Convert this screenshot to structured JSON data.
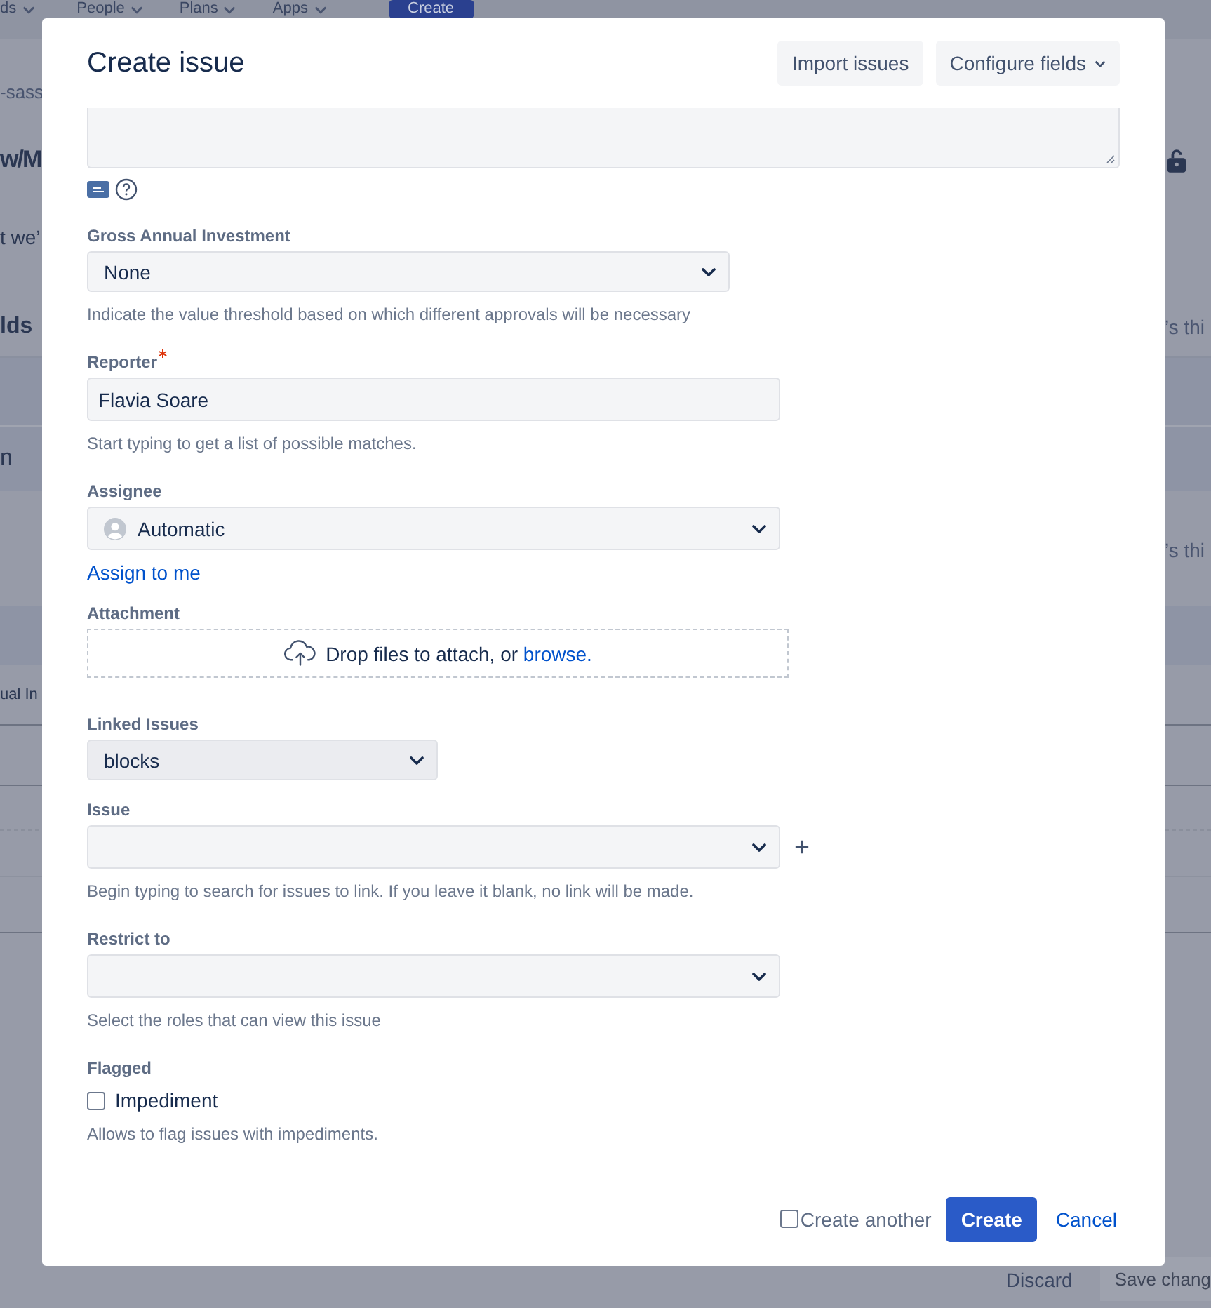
{
  "background_page": {
    "nav_items": [
      {
        "label": "ds"
      },
      {
        "label": "People"
      },
      {
        "label": "Plans"
      },
      {
        "label": "Apps"
      }
    ],
    "nav_create": "Create",
    "breadcrumb": "-sass",
    "heading": "w/M",
    "intro": "t we’",
    "section_title": "lds",
    "row_text": "n",
    "right_texts": [
      "’s thi",
      "’s thi"
    ],
    "field_row": "ual In",
    "discard": "Discard",
    "save": "Save chang"
  },
  "dialog": {
    "title": "Create issue",
    "header_buttons": [
      {
        "label": "Import issues",
        "kind": "plain"
      },
      {
        "label": "Configure fields",
        "kind": "dropdown"
      }
    ],
    "fields": [
      {
        "kind": "textarea"
      },
      {
        "kind": "select",
        "label": "Gross Annual Investment",
        "value": "None",
        "help": "Indicate the value threshold based on which different approvals will be necessary"
      },
      {
        "kind": "text",
        "label": "Reporter",
        "required": true,
        "value": "Flavia Soare",
        "help": "Start typing to get a list of possible matches."
      },
      {
        "kind": "user",
        "label": "Assignee",
        "value": "Automatic",
        "link": "Assign to me"
      },
      {
        "kind": "attachment",
        "label": "Attachment",
        "prompt": "Drop files to attach, or",
        "link": "browse."
      },
      {
        "kind": "link-type",
        "label": "Linked Issues",
        "value": "blocks"
      },
      {
        "kind": "issue-picker",
        "label": "Issue",
        "help": "Begin typing to search for issues to link. If you leave it blank, no link will be made."
      },
      {
        "kind": "multi-select",
        "label": "Restrict to",
        "help": "Select the roles that can view this issue"
      },
      {
        "kind": "checkbox",
        "label": "Flagged",
        "option": "Impediment",
        "checked": false,
        "help": "Allows to flag issues with impediments."
      }
    ],
    "create_another": {
      "label": "Create another",
      "checked": false
    },
    "submit": "Create",
    "cancel": "Cancel"
  }
}
